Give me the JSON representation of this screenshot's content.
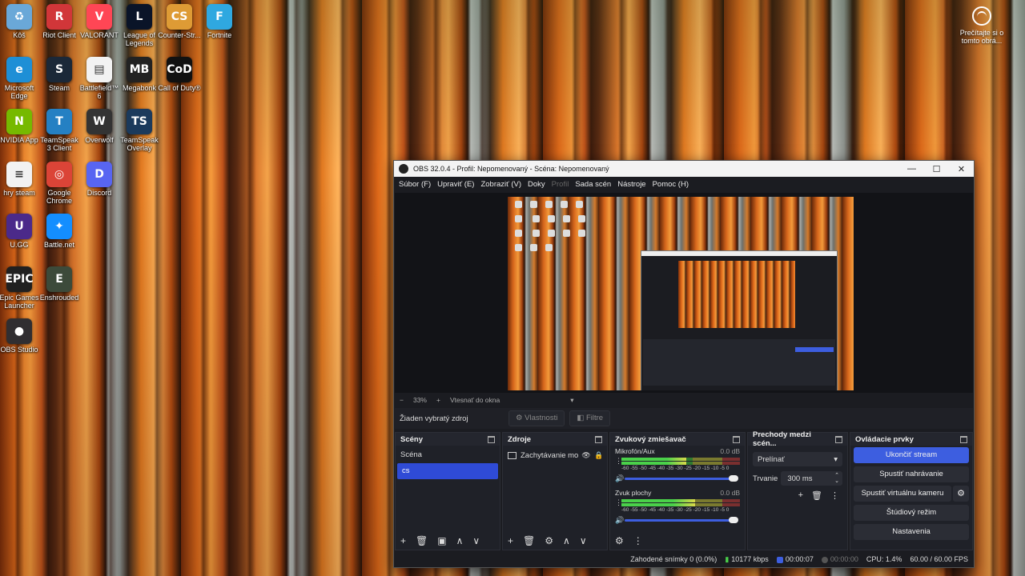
{
  "desktop": {
    "icons": [
      {
        "label": "Kôš",
        "icon": "recycle-bin-icon",
        "color": "#6aa8d8"
      },
      {
        "label": "Riot Client",
        "icon": "riot-icon",
        "color": "#d13639"
      },
      {
        "label": "VALORANT",
        "icon": "valorant-icon",
        "color": "#ff4655"
      },
      {
        "label": "League of Legends",
        "icon": "league-icon",
        "color": "#0a1428"
      },
      {
        "label": "Counter-Str...",
        "icon": "counter-strike-icon",
        "color": "#de9b35"
      },
      {
        "label": "Fortnite",
        "icon": "fortnite-icon",
        "color": "#2fa8e0"
      },
      {
        "label": "Microsoft Edge",
        "icon": "edge-icon",
        "color": "#1e8fd6"
      },
      {
        "label": "Steam",
        "icon": "steam-icon",
        "color": "#1b2838"
      },
      {
        "label": "Battlefield™ 6",
        "icon": "file-icon",
        "color": "#f2f2f2"
      },
      {
        "label": "Megabonk",
        "icon": "megabonk-icon",
        "color": "#222222"
      },
      {
        "label": "Call of Duty®",
        "icon": "call-of-duty-icon",
        "color": "#111111"
      },
      {
        "label": "NVIDIA App",
        "icon": "nvidia-icon",
        "color": "#76b900"
      },
      {
        "label": "TeamSpeak 3 Client",
        "icon": "teamspeak-icon",
        "color": "#2580c3"
      },
      {
        "label": "Overwolf",
        "icon": "overwolf-icon",
        "color": "#333333"
      },
      {
        "label": "TeamSpeak Overlay",
        "icon": "teamspeak-overlay-icon",
        "color": "#1b3a5c"
      },
      {
        "label": "hry steam",
        "icon": "text-file-icon",
        "color": "#f2f2f2"
      },
      {
        "label": "Google Chrome",
        "icon": "chrome-icon",
        "color": "#db4437"
      },
      {
        "label": "Discord",
        "icon": "discord-icon",
        "color": "#5865f2"
      },
      {
        "label": "U.GG",
        "icon": "ugg-icon",
        "color": "#4b2a8a"
      },
      {
        "label": "Battle.net",
        "icon": "battlenet-icon",
        "color": "#148eff"
      },
      {
        "label": "Epic Games Launcher",
        "icon": "epic-games-icon",
        "color": "#202020"
      },
      {
        "label": "Enshrouded",
        "icon": "enshrouded-icon",
        "color": "#3c4a3a"
      },
      {
        "label": "OBS Studio",
        "icon": "obs-icon",
        "color": "#302e31"
      }
    ],
    "icon_glyphs": [
      "♻",
      "R",
      "V",
      "L",
      "CS",
      "F",
      "e",
      "S",
      "▤",
      "MB",
      "CoD",
      "N",
      "T",
      "W",
      "TS",
      "≡",
      "◎",
      "D",
      "U",
      "✦",
      "EPIC",
      "E",
      "●"
    ],
    "notification": "Prečítajte si o tomto obrá..."
  },
  "obs": {
    "title": "OBS 32.0.4 - Profil: Nepomenovaný - Scéna: Nepomenovaný",
    "window_buttons": {
      "minimize": "—",
      "maximize": "☐",
      "close": "✕"
    },
    "menu": [
      "Súbor (F)",
      "Upraviť (E)",
      "Zobraziť (V)",
      "Doky",
      "Profil",
      "Sada scén",
      "Nástroje",
      "Pomoc (H)"
    ],
    "menu_disabled": "Profil",
    "zoom": {
      "minus": "−",
      "level": "33%",
      "plus": "+",
      "mode": "Vtesnať do okna",
      "caret": "▾"
    },
    "source_bar": {
      "no_selection": "Žiaden vybratý zdroj",
      "properties": "⚙ Vlastnosti",
      "filters": "◧ Filtre"
    },
    "scenes": {
      "title": "Scény",
      "items": [
        "Scéna",
        "cs"
      ],
      "selected": "cs",
      "footer": [
        "+",
        "🗑",
        "▣",
        "∧",
        "∨"
      ]
    },
    "sources": {
      "title": "Zdroje",
      "items": [
        {
          "name": "Zachytávanie mo",
          "eye": "👁",
          "lock": "🔒"
        }
      ],
      "footer": [
        "+",
        "🗑",
        "⚙",
        "∧",
        "∨"
      ]
    },
    "mixer": {
      "title": "Zvukový zmiešavač",
      "channels": [
        {
          "name": "Mikrofón/Aux",
          "db": "0.0 dB",
          "level": 0.55
        },
        {
          "name": "Zvuk plochy",
          "db": "0.0 dB",
          "level": 0.62
        }
      ],
      "ticks": "-60 -55 -50 -45 -40 -35 -30 -25 -20 -15 -10 -5 0",
      "footer": [
        "⚙",
        "⋮"
      ]
    },
    "transitions": {
      "title": "Prechody medzi scén...",
      "selected": "Prelínať",
      "duration_label": "Trvanie",
      "duration_value": "300 ms",
      "tools": [
        "+",
        "🗑",
        "⋮"
      ]
    },
    "controls": {
      "title": "Ovládacie prvky",
      "stop_stream": "Ukončiť stream",
      "start_recording": "Spustiť nahrávanie",
      "start_virtual_camera": "Spustiť virtuálnu kameru",
      "studio_mode": "Štúdiový režim",
      "settings": "Nastavenia"
    },
    "status": {
      "dropped_frames": "Zahodené snímky 0 (0.0%)",
      "bitrate": "10177 kbps",
      "live_time": "00:00:07",
      "rec_time": "00:00:00",
      "cpu": "CPU: 1.4%",
      "fps": "60.00 / 60.00 FPS"
    },
    "colors": {
      "accent": "#3d5ee0",
      "bg": "#1b1c21",
      "dock": "#1f2128"
    }
  }
}
